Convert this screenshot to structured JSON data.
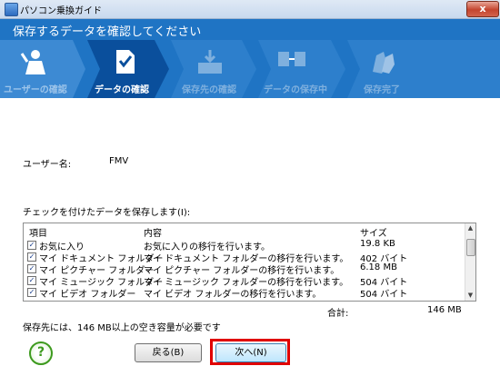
{
  "window": {
    "title": "パソコン乗換ガイド",
    "close_glyph": "x"
  },
  "header": {
    "title": "保存するデータを確認してください"
  },
  "steps": [
    {
      "label": "ユーザーの確認",
      "state": "done"
    },
    {
      "label": "データの確認",
      "state": "current"
    },
    {
      "label": "保存先の確認",
      "state": "pending"
    },
    {
      "label": "データの保存中",
      "state": "pending"
    },
    {
      "label": "保存完了",
      "state": "pending"
    }
  ],
  "user": {
    "label": "ユーザー名:",
    "value": "FMV"
  },
  "list": {
    "caption": "チェックを付けたデータを保存します(I):",
    "columns": [
      "項目",
      "内容",
      "サイズ"
    ],
    "rows": [
      {
        "checked": true,
        "item": "お気に入り",
        "content": "お気に入りの移行を行います。",
        "size": "19.8 KB"
      },
      {
        "checked": true,
        "item": "マイ ドキュメント フォルダー",
        "content": "マイ ドキュメント フォルダーの移行を行います。",
        "size": "402 バイト"
      },
      {
        "checked": true,
        "item": "マイ ピクチャー フォルダー",
        "content": "マイ ピクチャー フォルダーの移行を行います。",
        "size": "6.18 MB"
      },
      {
        "checked": true,
        "item": "マイ ミュージック フォルダー",
        "content": "マイ ミュージック フォルダーの移行を行います。",
        "size": "504 バイト"
      },
      {
        "checked": true,
        "item": "マイ ビデオ フォルダー",
        "content": "マイ ビデオ フォルダーの移行を行います。",
        "size": "504 バイト"
      }
    ]
  },
  "total": {
    "label": "合計:",
    "value": "146 MB"
  },
  "capacity_note": "保存先には、146 MB以上の空き容量が必要です",
  "buttons": {
    "help": "?",
    "back": "戻る(B)",
    "next": "次へ(N)"
  },
  "colors": {
    "header_blue": "#1f74c4",
    "step_current": "#0a4f9c",
    "step_pending": "#7fb0de",
    "highlight": "#e00000"
  }
}
